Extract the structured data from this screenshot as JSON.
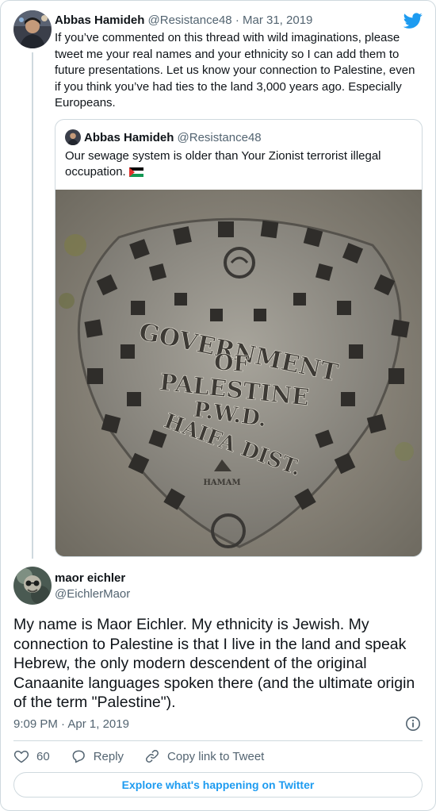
{
  "parent_tweet": {
    "author_name": "Abbas Hamideh",
    "handle": "@Resistance48",
    "separator": "·",
    "date": "Mar 31, 2019",
    "text": "If you’ve commented on this thread with wild imaginations, please tweet me your real names and your ethnicity so I can add them to future presentations. Let us know your connection to Palestine, even if you think you’ve had ties to the land 3,000 years ago. Especially Europeans."
  },
  "quoted_tweet": {
    "author_name": "Abbas Hamideh",
    "handle": "@Resistance48",
    "text": "Our sewage system is older than Your Zionist terrorist illegal occupation.",
    "flag_icon": "palestine-flag-icon",
    "image": {
      "lines": [
        "GOVERNMENT",
        "OF",
        "PALESTINE",
        "P.W.D.",
        "HAIFA DIST."
      ],
      "maker": "HAMAM"
    }
  },
  "main_tweet": {
    "author_name": "maor eichler",
    "handle": "@EichlerMaor",
    "text": "My name is Maor Eichler. My ethnicity is Jewish. My connection to Palestine is that I live in the land and speak Hebrew, the only modern descendent of the original Canaanite languages spoken there (and the ultimate origin of the term \"Palestine\").",
    "time": "9:09 PM",
    "separator": "·",
    "date": "Apr 1, 2019"
  },
  "actions": {
    "like_count": "60",
    "reply_label": "Reply",
    "copy_link_label": "Copy link to Tweet"
  },
  "explore_label": "Explore what's happening on Twitter",
  "colors": {
    "accent": "#1d9bf0",
    "text": "#0f1419",
    "secondary": "#536471",
    "border": "#cfd9de"
  },
  "icons": [
    "twitter-logo-icon",
    "info-icon",
    "heart-icon",
    "reply-icon",
    "link-icon"
  ]
}
